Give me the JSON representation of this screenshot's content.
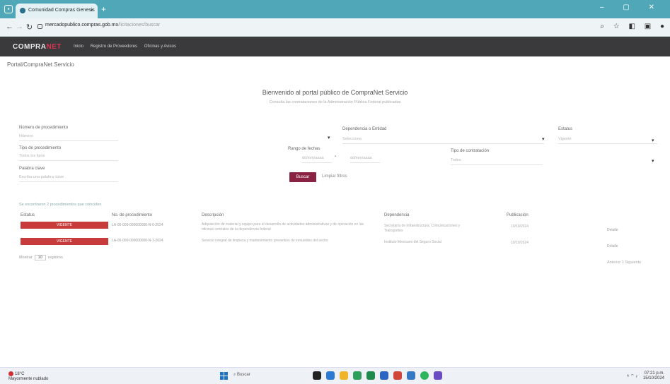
{
  "browser": {
    "tab_title": "Comunidad Compras Genesis",
    "url_host": "mercadopublico.compras.gob.mx",
    "url_path": "/licitaciones/buscar",
    "new_tab": "+",
    "close": "×",
    "window_controls": "– ▢ ✕"
  },
  "site": {
    "logo_main": "COMPRA",
    "logo_accent": "NET",
    "menu": [
      "Inicio",
      "Registro de Proveedores",
      "Oficinas y Avisos"
    ]
  },
  "breadcrumb": "Portal/CompraNet Servicio",
  "hero": {
    "title": "Bienvenido al portal público de CompraNet Servicio",
    "subtitle": "Consulta las contrataciones de la Administración Pública Federal publicadas"
  },
  "filters": {
    "number_label": "Número de procedimiento",
    "number_placeholder": "Número",
    "entity_label": "Dependencia o Entidad",
    "entity_placeholder": "Selecciona",
    "status_label": "Estatus",
    "status_placeholder": "Vigente",
    "type_label": "Tipo de procedimiento",
    "type_placeholder": "Todos los tipos",
    "dates_label": "Rango de fechas",
    "date_from": "dd/mm/aaaa",
    "date_to": "dd/mm/aaaa",
    "contract_label": "Tipo de contratación",
    "contract_placeholder": "Todos",
    "keyword_label": "Palabra clave",
    "keyword_placeholder": "Escriba una palabra clave",
    "search_button": "Buscar",
    "clear_button": "Limpiar filtros"
  },
  "results": {
    "count_text": "Se encontraron 2 procedimientos que coinciden",
    "headers": [
      "Estatus",
      "No. de procedimiento",
      "Descripción",
      "Dependencia",
      "Publicación",
      ""
    ],
    "rows": [
      {
        "status": "VIGENTE",
        "number": "LA-00-000-000000000-N-0-2024",
        "description": "Adquisición de material y equipo para el desarrollo de actividades administrativas y de operación en las oficinas centrales de la dependencia federal",
        "dependency": "Secretaría de Infraestructura, Comunicaciones y Transportes",
        "date": "10/10/2024",
        "action": "Detalle"
      },
      {
        "status": "VIGENTE",
        "number": "LA-00-000-000000000-N-1-2024",
        "description": "Servicio integral de limpieza y mantenimiento preventivo de inmuebles del sector",
        "dependency": "Instituto Mexicano del Seguro Social",
        "date": "10/10/2024",
        "action": "Detalle"
      }
    ],
    "page_size_label": "Mostrar",
    "page_size": "10",
    "page_size_suffix": "registros",
    "pager": "Anterior 1 Siguiente"
  },
  "taskbar": {
    "weather_temp": "18°C",
    "weather_desc": "Mayormente nublado",
    "search": "Buscar",
    "time": "07:21 p.m.",
    "date": "15/10/2024"
  }
}
